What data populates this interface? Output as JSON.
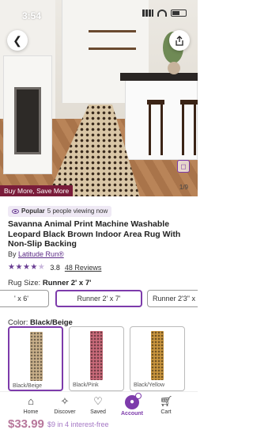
{
  "status_bar": {
    "time": "3:54"
  },
  "hero": {
    "image_counter": "1/9",
    "promo_banner": "Buy More, Save More",
    "back_icon": "chevron-left-icon",
    "share_icon": "share-icon",
    "zoom_icon": "view-in-room-icon"
  },
  "popular_badge": {
    "label": "Popular",
    "text": "5 people viewing now"
  },
  "product": {
    "title": "Savanna Animal Print Machine Washable Leopard Black Brown Indoor Area Rug With Non-Slip Backing",
    "by_label": "By",
    "brand": "Latitude Run®",
    "rating": "3.8",
    "stars_filled": 4,
    "reviews": "48 Reviews"
  },
  "rug_size": {
    "label": "Rug Size:",
    "selected": "Runner 2' x 7'",
    "options": [
      "' x 6'",
      "Runner 2' x 7'",
      "Runner 2'3\" x"
    ]
  },
  "color": {
    "label": "Color:",
    "selected": "Black/Beige",
    "options": [
      {
        "name": "Black/Beige",
        "swatch": "#c9b08a"
      },
      {
        "name": "Black/Pink",
        "swatch": "#c96a7a"
      },
      {
        "name": "Black/Yellow",
        "swatch": "#c9953e"
      }
    ]
  },
  "price": {
    "amount": "$33.99",
    "installments": "$9 in 4 interest-free"
  },
  "bottom_nav": [
    {
      "label": "Home",
      "icon": "home-icon"
    },
    {
      "label": "Discover",
      "icon": "sparkle-icon"
    },
    {
      "label": "Saved",
      "icon": "heart-icon"
    },
    {
      "label": "Account",
      "icon": "account-icon"
    },
    {
      "label": "Cart",
      "icon": "cart-icon"
    }
  ],
  "accent_color": "#7d3bab"
}
